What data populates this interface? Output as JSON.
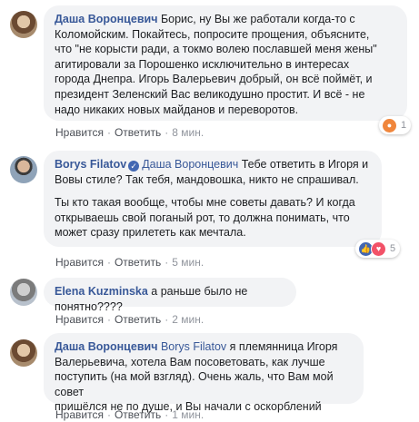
{
  "comments": [
    {
      "author": "Даша Воронцевич",
      "text": "Борис, ну Вы же работали когда-то с\nКоломойским. Покайтесь, попросите прощения, объясните,\nчто \"не корысти ради, а токмо волею пославшей меня жены\"\nагитировали за Порошенко исключительно в интересах\nгорода Днепра. Игорь Валерьевич добрый, он всё поймёт, и\nпрезидент Зеленский Вас великодушно простит. И всё - не\nнадо никаких новых майданов и переворотов.",
      "like": "Нравится",
      "reply": "Ответить",
      "time": "8 мин.",
      "reaction_count": "1",
      "reactions": [
        "angry-reaction-icon"
      ]
    },
    {
      "author": "Borys Filatov",
      "mention": "Даша Воронцевич",
      "text_inline": " Тебе ответить в Игоря и\nВовы стиле? Так тебя, мандовошка, никто не спрашивал.",
      "text_extra": "Ты кто такая вообще, чтобы мне советы давать? И когда\nоткрываешь свой поганый рот, то должна понимать, что\nможет сразу прилететь как мечтала.",
      "like": "Нравится",
      "reply": "Ответить",
      "time": "5 мин.",
      "reaction_count": "5",
      "reactions": [
        "like-reaction-icon",
        "love-reaction-icon"
      ]
    },
    {
      "author": "Elena Kuzminska",
      "text": " а раньше было не понятно????",
      "like": "Нравится",
      "reply": "Ответить",
      "time": "2 мин."
    },
    {
      "author": "Даша Воронцевич",
      "mention": "Borys Filatov",
      "text": " я племянница Игоря\nВалерьевича, хотела Вам посоветовать, как лучше\nпоступить (на мой взгляд). Очень жаль, что Вам мой совет\nпришёлся не по душе, и Вы начали с оскорблений",
      "like": "Нравится",
      "reply": "Ответить",
      "time": "1 мин."
    }
  ],
  "separator": "·",
  "verified_glyph": "✓",
  "colors": {
    "name": "#385898",
    "bubble": "#f2f3f5",
    "meta": "#90949c"
  }
}
